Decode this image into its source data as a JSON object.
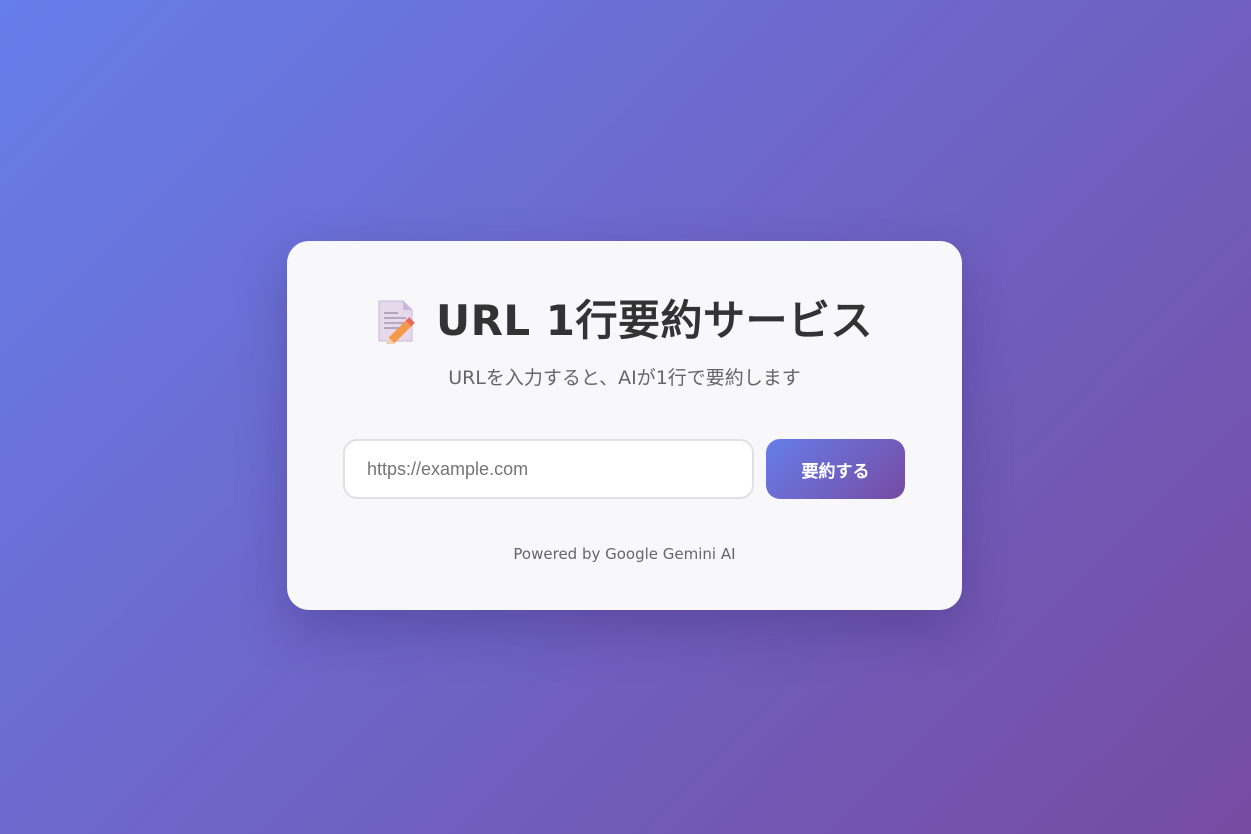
{
  "header": {
    "icon": "memo-icon",
    "title": "URL 1行要約サービス",
    "subtitle": "URLを入力すると、AIが1行で要約します"
  },
  "form": {
    "url_placeholder": "https://example.com",
    "url_value": "",
    "submit_label": "要約する"
  },
  "footer": {
    "text": "Powered by Google Gemini AI"
  },
  "colors": {
    "gradient_start": "#667eea",
    "gradient_end": "#764ba2",
    "card_background": "#f8f8fb",
    "title_text": "#333333",
    "muted_text": "#666666"
  }
}
